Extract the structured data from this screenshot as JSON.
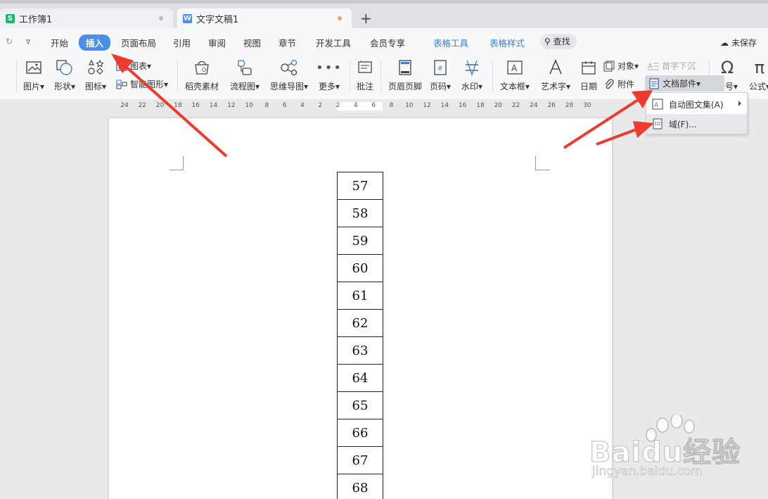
{
  "tabs": [
    {
      "label": "工作簿1",
      "icon": "spreadsheet-icon",
      "color": "#1bb76e"
    },
    {
      "label": "文字文稿1",
      "icon": "writer-doc-icon",
      "color": "#4a8af4",
      "dot_color": "#f5a05a"
    }
  ],
  "new_tab": "+",
  "menu": {
    "items": [
      "开始",
      "插入",
      "页面布局",
      "引用",
      "审阅",
      "视图",
      "章节",
      "开发工具",
      "会员专享",
      "表格工具",
      "表格样式"
    ],
    "active": "插入",
    "search": "查找",
    "cloud_status": "未保存"
  },
  "toolbar": {
    "picture": "图片",
    "shape": "形状",
    "icon": "图标",
    "chart": "图表",
    "smart_graphic": "智能图形",
    "docer_material": "稻壳素材",
    "flowchart": "流程图",
    "mindmap": "思维导图",
    "more": "更多",
    "comment": "批注",
    "header_footer": "页眉页脚",
    "page_number": "页码",
    "watermark": "水印",
    "textbox": "文本框",
    "wordart": "艺术字",
    "date": "日期",
    "object": "对象",
    "attachment": "附件",
    "drop_cap": "首字下沉",
    "doc_parts": "文档部件",
    "symbol": "符号",
    "formula": "公式"
  },
  "ruler": [
    "24",
    "22",
    "20",
    "18",
    "16",
    "14",
    "12",
    "10",
    "8",
    "6",
    "4",
    "2",
    "2",
    "4",
    "6",
    "8",
    "10",
    "12",
    "14",
    "16",
    "18",
    "20",
    "22",
    "24",
    "26",
    "28",
    "30"
  ],
  "table_values": [
    "57",
    "58",
    "59",
    "60",
    "61",
    "62",
    "63",
    "64",
    "65",
    "66",
    "67",
    "68"
  ],
  "dropdown": {
    "items": [
      "自动图文集(A)",
      "域(F)..."
    ]
  },
  "watermark": {
    "brand": "Baidu经验",
    "url": "jingyan.baidu.com"
  },
  "colors": {
    "accent": "#4c8fea",
    "arrow": "#f03a2e",
    "table_tools": "#3b7fd9"
  }
}
